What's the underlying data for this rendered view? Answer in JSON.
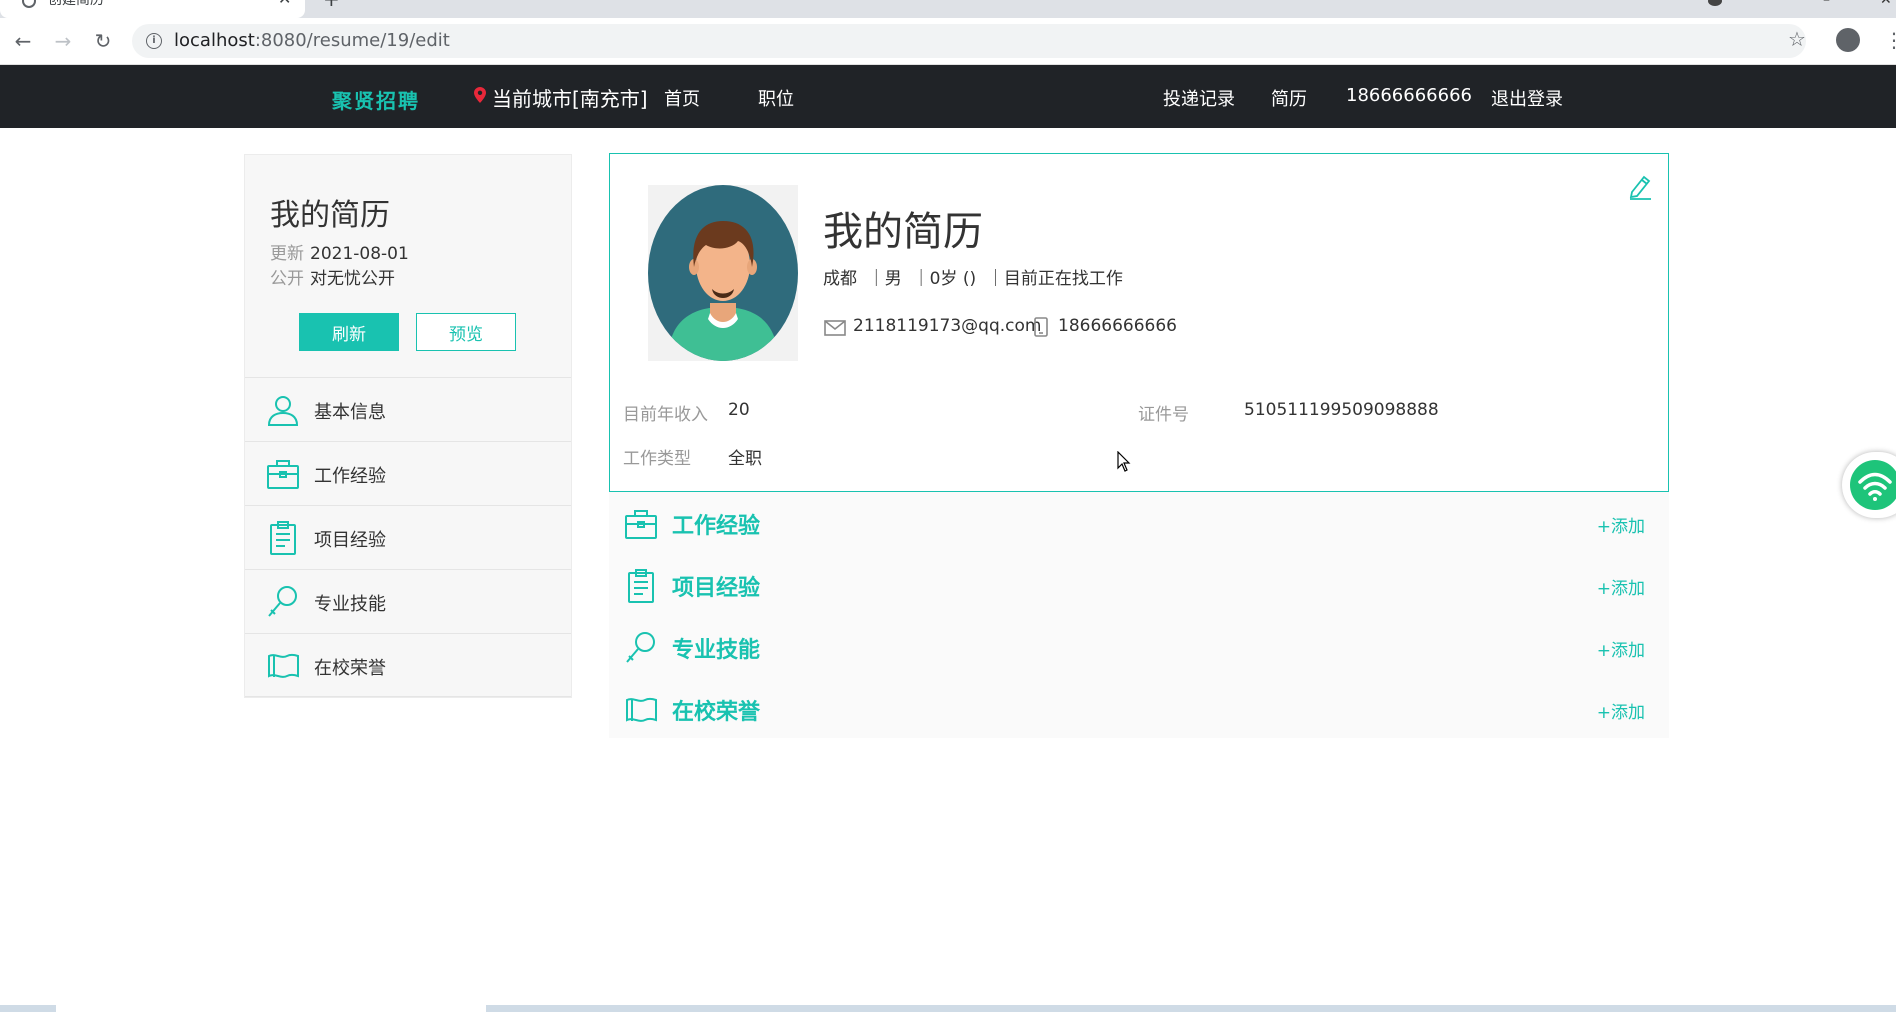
{
  "browser": {
    "tab_title": "创建简历",
    "url_host": "localhost",
    "url_path": ":8080/resume/19/edit"
  },
  "header": {
    "logo": "聚贤招聘",
    "city": "当前城市[南充市]",
    "nav": {
      "home": "首页",
      "jobs": "职位",
      "deliver": "投递记录",
      "resume": "简历",
      "phone": "18666666666",
      "logout": "退出登录"
    }
  },
  "sidebar": {
    "title": "我的简历",
    "update_label": "更新",
    "update_value": "2021-08-01",
    "public_label": "公开",
    "public_value": "对无忧公开",
    "refresh_label": "刷新",
    "preview_label": "预览",
    "items": [
      {
        "label": "基本信息"
      },
      {
        "label": "工作经验"
      },
      {
        "label": "项目经验"
      },
      {
        "label": "专业技能"
      },
      {
        "label": "在校荣誉"
      }
    ]
  },
  "profile": {
    "name": "我的简历",
    "basic": "成都  ｜男  ｜0岁 ()  ｜目前正在找工作",
    "email": "2118119173@qq.com",
    "phone": "18666666666",
    "income_label": "目前年收入",
    "income_value": "20",
    "id_label": "证件号",
    "id_value": "510511199509098888",
    "worktype_label": "工作类型",
    "worktype_value": "全职"
  },
  "sections": [
    {
      "title": "工作经验",
      "add": "+添加"
    },
    {
      "title": "项目经验",
      "add": "+添加"
    },
    {
      "title": "专业技能",
      "add": "+添加"
    },
    {
      "title": "在校荣誉",
      "add": "+添加"
    }
  ],
  "colors": {
    "accent": "#19c2b0",
    "header_bg": "#202327"
  }
}
